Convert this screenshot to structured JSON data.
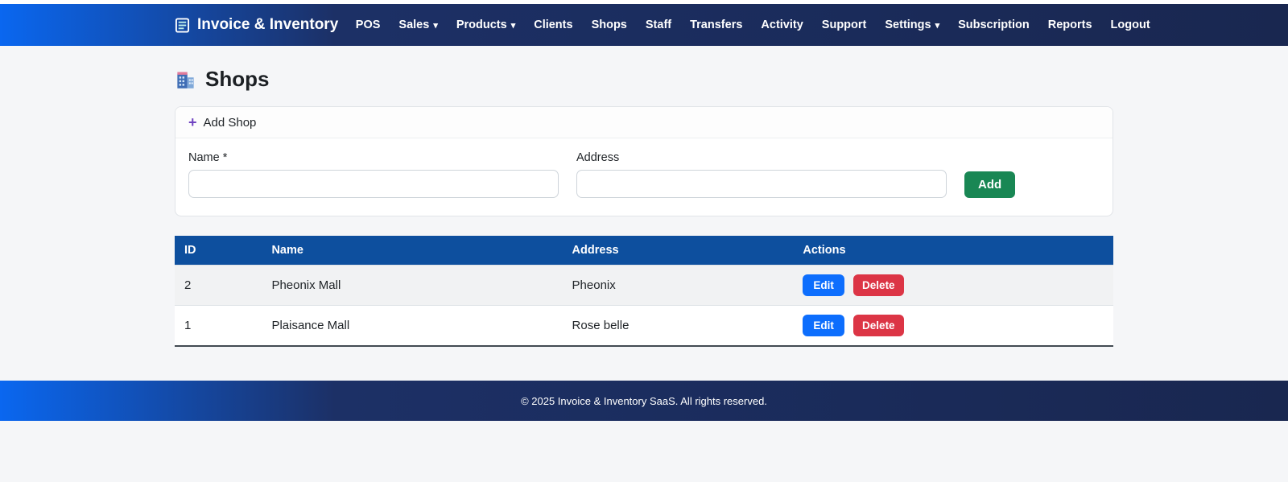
{
  "navbar": {
    "brand": "Invoice & Inventory",
    "items": [
      {
        "label": "POS",
        "dropdown": false
      },
      {
        "label": "Sales",
        "dropdown": true
      },
      {
        "label": "Products",
        "dropdown": true
      },
      {
        "label": "Clients",
        "dropdown": false
      },
      {
        "label": "Shops",
        "dropdown": false
      },
      {
        "label": "Staff",
        "dropdown": false
      },
      {
        "label": "Transfers",
        "dropdown": false
      },
      {
        "label": "Activity",
        "dropdown": false
      },
      {
        "label": "Support",
        "dropdown": false
      },
      {
        "label": "Settings",
        "dropdown": true
      },
      {
        "label": "Subscription",
        "dropdown": false
      },
      {
        "label": "Reports",
        "dropdown": false
      },
      {
        "label": "Logout",
        "dropdown": false
      }
    ]
  },
  "icons": {
    "caret": "▾",
    "plus": "+"
  },
  "page": {
    "title": "Shops"
  },
  "add_shop_card": {
    "header": "Add Shop",
    "name_label": "Name *",
    "name_value": "",
    "address_label": "Address",
    "address_value": "",
    "add_button": "Add"
  },
  "table": {
    "headers": [
      "ID",
      "Name",
      "Address",
      "Actions"
    ],
    "rows": [
      {
        "id": "2",
        "name": "Pheonix Mall",
        "address": "Pheonix"
      },
      {
        "id": "1",
        "name": "Plaisance Mall",
        "address": "Rose belle"
      }
    ],
    "edit_label": "Edit",
    "delete_label": "Delete"
  },
  "footer": {
    "text": "© 2025 Invoice & Inventory SaaS. All rights reserved."
  },
  "colors": {
    "nav_gradient_start": "#0a67f0",
    "nav_gradient_end": "#192750",
    "table_header": "#0d4f9e",
    "add_button": "#198754",
    "edit_button": "#0d6efd",
    "delete_button": "#dc3545",
    "plus_icon": "#6f42c1",
    "page_background": "#f5f6f8"
  }
}
